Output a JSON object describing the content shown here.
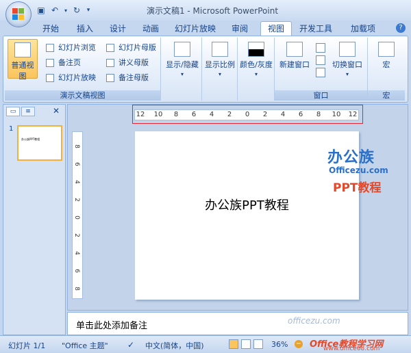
{
  "window": {
    "title": "演示文稿1 - Microsoft PowerPoint"
  },
  "ribbon_tabs": [
    "开始",
    "插入",
    "设计",
    "动画",
    "幻灯片放映",
    "审阅",
    "视图",
    "开发工具",
    "加载项"
  ],
  "active_tab": "视图",
  "groups": {
    "presentation_views": {
      "label": "演示文稿视图",
      "normal": "普通视图",
      "slide_sorter": "幻灯片浏览",
      "notes_page": "备注页",
      "slide_show": "幻灯片放映",
      "slide_master": "幻灯片母版",
      "handout_master": "讲义母版",
      "notes_master": "备注母版"
    },
    "show_hide": {
      "label": "显示/隐藏"
    },
    "zoom": {
      "label": "显示比例"
    },
    "color": {
      "label": "颜色/灰度"
    },
    "window": {
      "label": "窗口",
      "new_window": "新建窗口",
      "switch_window": "切换窗口"
    },
    "macros": {
      "label": "宏",
      "button": "宏"
    }
  },
  "ruler": {
    "horizontal": [
      "12",
      "10",
      "8",
      "6",
      "4",
      "2",
      "0",
      "2",
      "4",
      "6",
      "8",
      "10",
      "12"
    ],
    "vertical": [
      "8",
      "6",
      "4",
      "2",
      "0",
      "2",
      "4",
      "6",
      "8"
    ]
  },
  "slide": {
    "number": "1",
    "text": "办公族PPT教程"
  },
  "notes": {
    "placeholder": "单击此处添加备注"
  },
  "watermark": {
    "brand": "办公族",
    "site": "Officezu.com",
    "subtitle": "PPT教程",
    "notes_mark": "officezu.com",
    "bottom_title": "Office教程学习网",
    "bottom_url": "www.office68.com"
  },
  "status": {
    "slide": "幻灯片 1/1",
    "theme": "\"Office 主题\"",
    "language": "中文(简体，中国)",
    "zoom": "36%"
  }
}
